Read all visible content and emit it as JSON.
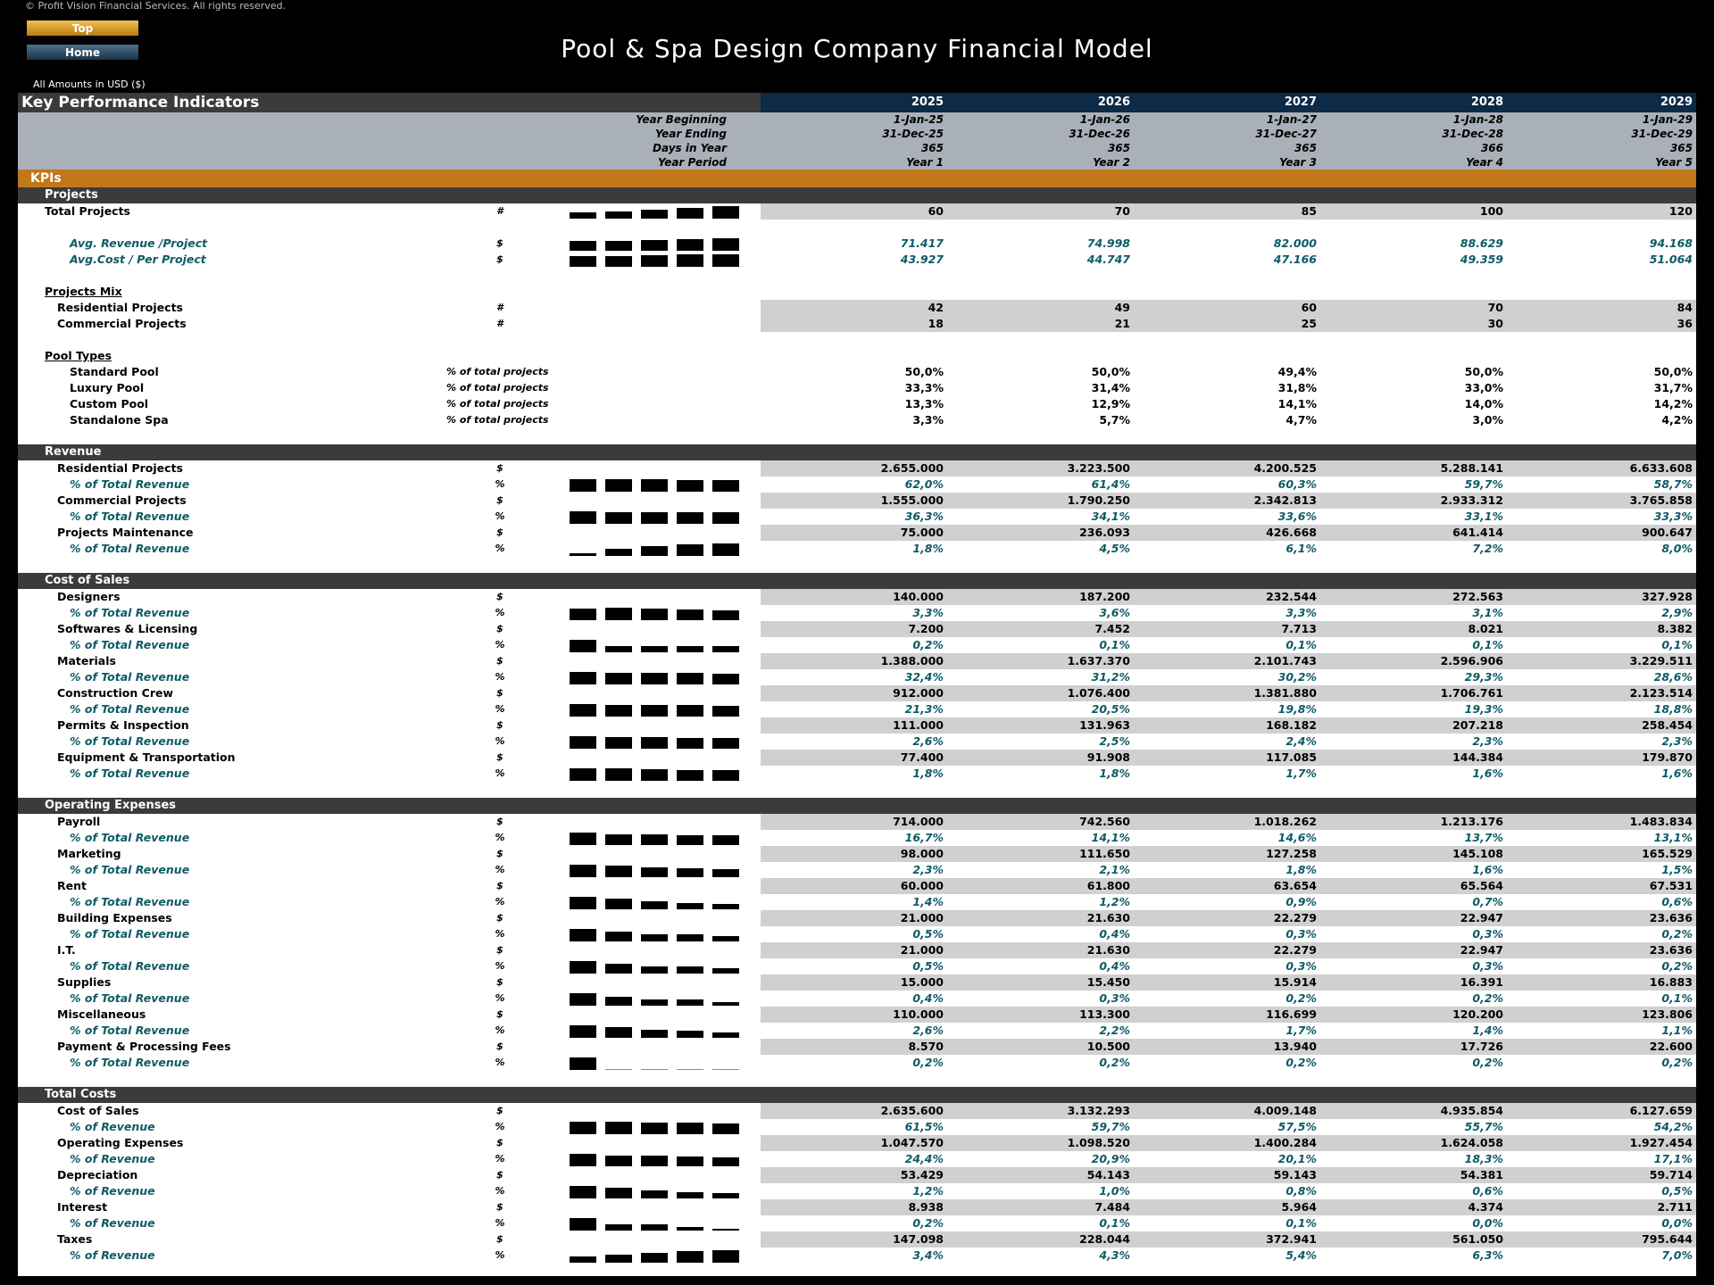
{
  "header": {
    "copyright": "© Profit Vision Financial Services. All rights reserved.",
    "btn_top": "Top",
    "btn_home": "Home",
    "title": "Pool & Spa Design Company Financial Model",
    "amounts": "All Amounts in  USD ($)"
  },
  "table": {
    "title": "Key Performance Indicators",
    "years": [
      "2025",
      "2026",
      "2027",
      "2028",
      "2029"
    ],
    "meta": [
      {
        "label": "Year Beginning",
        "values": [
          "1-Jan-25",
          "1-Jan-26",
          "1-Jan-27",
          "1-Jan-28",
          "1-Jan-29"
        ]
      },
      {
        "label": "Year Ending",
        "values": [
          "31-Dec-25",
          "31-Dec-26",
          "31-Dec-27",
          "31-Dec-28",
          "31-Dec-29"
        ]
      },
      {
        "label": "Days in Year",
        "values": [
          "365",
          "365",
          "365",
          "366",
          "365"
        ]
      },
      {
        "label": "Year Period",
        "values": [
          "Year 1",
          "Year 2",
          "Year 3",
          "Year 4",
          "Year 5"
        ]
      }
    ],
    "band": "KPIs"
  },
  "sections": [
    {
      "type": "sec",
      "label": "Projects"
    },
    {
      "type": "row",
      "style": "main",
      "indent": "l0",
      "label": "Total Projects",
      "unit": "#",
      "spark": [
        60,
        70,
        85,
        100,
        120
      ],
      "values": [
        "60",
        "70",
        "85",
        "100",
        "120"
      ]
    },
    {
      "type": "blank"
    },
    {
      "type": "row",
      "style": "teal",
      "indent": "l2",
      "label": "Avg. Revenue /Project",
      "unit": "$",
      "spark": [
        71.417,
        74.998,
        82.0,
        88.629,
        94.168
      ],
      "values": [
        "71.417",
        "74.998",
        "82.000",
        "88.629",
        "94.168"
      ]
    },
    {
      "type": "row",
      "style": "teal",
      "indent": "l2",
      "label": "Avg.Cost / Per Project",
      "unit": "$",
      "spark": [
        43.927,
        44.747,
        47.166,
        49.359,
        51.064
      ],
      "values": [
        "43.927",
        "44.747",
        "47.166",
        "49.359",
        "51.064"
      ]
    },
    {
      "type": "blank"
    },
    {
      "type": "sub",
      "label": "Projects Mix"
    },
    {
      "type": "row",
      "style": "main",
      "indent": "l1",
      "label": "Residential Projects",
      "unit": "#",
      "values": [
        "42",
        "49",
        "60",
        "70",
        "84"
      ]
    },
    {
      "type": "row",
      "style": "main",
      "indent": "l1",
      "label": "Commercial Projects",
      "unit": "#",
      "values": [
        "18",
        "21",
        "25",
        "30",
        "36"
      ]
    },
    {
      "type": "blank"
    },
    {
      "type": "sub",
      "label": "Pool Types"
    },
    {
      "type": "row",
      "style": "plain",
      "indent": "l2b",
      "label": "Standard Pool",
      "unit": "% of total projects",
      "unitAlign": "l",
      "values": [
        "50,0%",
        "50,0%",
        "49,4%",
        "50,0%",
        "50,0%"
      ]
    },
    {
      "type": "row",
      "style": "plain",
      "indent": "l2b",
      "label": "Luxury Pool",
      "unit": "% of total projects",
      "unitAlign": "l",
      "values": [
        "33,3%",
        "31,4%",
        "31,8%",
        "33,0%",
        "31,7%"
      ]
    },
    {
      "type": "row",
      "style": "plain",
      "indent": "l2b",
      "label": "Custom Pool",
      "unit": "% of total projects",
      "unitAlign": "l",
      "values": [
        "13,3%",
        "12,9%",
        "14,1%",
        "14,0%",
        "14,2%"
      ]
    },
    {
      "type": "row",
      "style": "plain",
      "indent": "l2b",
      "label": "Standalone Spa",
      "unit": "% of total projects",
      "unitAlign": "l",
      "values": [
        "3,3%",
        "5,7%",
        "4,7%",
        "3,0%",
        "4,2%"
      ]
    },
    {
      "type": "blank"
    },
    {
      "type": "sec",
      "label": "Revenue"
    },
    {
      "type": "row",
      "style": "main",
      "indent": "l1",
      "label": "Residential Projects",
      "unit": "$",
      "values": [
        "2.655.000",
        "3.223.500",
        "4.200.525",
        "5.288.141",
        "6.633.608"
      ]
    },
    {
      "type": "row",
      "style": "pct",
      "indent": "l2",
      "label": "% of Total Revenue",
      "unit": "%",
      "spark": [
        62.0,
        61.4,
        60.3,
        59.7,
        58.7
      ],
      "values": [
        "62,0%",
        "61,4%",
        "60,3%",
        "59,7%",
        "58,7%"
      ]
    },
    {
      "type": "row",
      "style": "main",
      "indent": "l1",
      "label": "Commercial Projects",
      "unit": "$",
      "values": [
        "1.555.000",
        "1.790.250",
        "2.342.813",
        "2.933.312",
        "3.765.858"
      ]
    },
    {
      "type": "row",
      "style": "pct",
      "indent": "l2",
      "label": "% of Total Revenue",
      "unit": "%",
      "spark": [
        36.3,
        34.1,
        33.6,
        33.1,
        33.3
      ],
      "values": [
        "36,3%",
        "34,1%",
        "33,6%",
        "33,1%",
        "33,3%"
      ]
    },
    {
      "type": "row",
      "style": "main",
      "indent": "l1",
      "label": "Projects Maintenance",
      "unit": "$",
      "values": [
        "75.000",
        "236.093",
        "426.668",
        "641.414",
        "900.647"
      ]
    },
    {
      "type": "row",
      "style": "pct",
      "indent": "l2",
      "label": "% of Total Revenue",
      "unit": "%",
      "spark": [
        1.8,
        4.5,
        6.1,
        7.2,
        8.0
      ],
      "values": [
        "1,8%",
        "4,5%",
        "6,1%",
        "7,2%",
        "8,0%"
      ]
    },
    {
      "type": "blank"
    },
    {
      "type": "sec",
      "label": "Cost of Sales"
    },
    {
      "type": "row",
      "style": "main",
      "indent": "l1",
      "label": "Designers",
      "unit": "$",
      "values": [
        "140.000",
        "187.200",
        "232.544",
        "272.563",
        "327.928"
      ]
    },
    {
      "type": "row",
      "style": "pct",
      "indent": "l2",
      "label": "% of Total Revenue",
      "unit": "%",
      "spark": [
        3.3,
        3.6,
        3.3,
        3.1,
        2.9
      ],
      "values": [
        "3,3%",
        "3,6%",
        "3,3%",
        "3,1%",
        "2,9%"
      ]
    },
    {
      "type": "row",
      "style": "main",
      "indent": "l1",
      "label": "Softwares & Licensing",
      "unit": "$",
      "values": [
        "7.200",
        "7.452",
        "7.713",
        "8.021",
        "8.382"
      ]
    },
    {
      "type": "row",
      "style": "pct",
      "indent": "l2",
      "label": "% of Total Revenue",
      "unit": "%",
      "spark": [
        0.2,
        0.1,
        0.1,
        0.1,
        0.1
      ],
      "values": [
        "0,2%",
        "0,1%",
        "0,1%",
        "0,1%",
        "0,1%"
      ]
    },
    {
      "type": "row",
      "style": "main",
      "indent": "l1",
      "label": "Materials",
      "unit": "$",
      "values": [
        "1.388.000",
        "1.637.370",
        "2.101.743",
        "2.596.906",
        "3.229.511"
      ]
    },
    {
      "type": "row",
      "style": "pct",
      "indent": "l2",
      "label": "% of Total Revenue",
      "unit": "%",
      "spark": [
        32.4,
        31.2,
        30.2,
        29.3,
        28.6
      ],
      "values": [
        "32,4%",
        "31,2%",
        "30,2%",
        "29,3%",
        "28,6%"
      ]
    },
    {
      "type": "row",
      "style": "main",
      "indent": "l1",
      "label": "Construction Crew",
      "unit": "$",
      "values": [
        "912.000",
        "1.076.400",
        "1.381.880",
        "1.706.761",
        "2.123.514"
      ]
    },
    {
      "type": "row",
      "style": "pct",
      "indent": "l2",
      "label": "% of Total Revenue",
      "unit": "%",
      "spark": [
        21.3,
        20.5,
        19.8,
        19.3,
        18.8
      ],
      "values": [
        "21,3%",
        "20,5%",
        "19,8%",
        "19,3%",
        "18,8%"
      ]
    },
    {
      "type": "row",
      "style": "main",
      "indent": "l1",
      "label": "Permits & Inspection",
      "unit": "$",
      "values": [
        "111.000",
        "131.963",
        "168.182",
        "207.218",
        "258.454"
      ]
    },
    {
      "type": "row",
      "style": "pct",
      "indent": "l2",
      "label": "% of Total Revenue",
      "unit": "%",
      "spark": [
        2.6,
        2.5,
        2.4,
        2.3,
        2.3
      ],
      "values": [
        "2,6%",
        "2,5%",
        "2,4%",
        "2,3%",
        "2,3%"
      ]
    },
    {
      "type": "row",
      "style": "main",
      "indent": "l1",
      "label": "Equipment & Transportation",
      "unit": "$",
      "values": [
        "77.400",
        "91.908",
        "117.085",
        "144.384",
        "179.870"
      ]
    },
    {
      "type": "row",
      "style": "pct",
      "indent": "l2",
      "label": "% of Total Revenue",
      "unit": "%",
      "spark": [
        1.8,
        1.8,
        1.7,
        1.6,
        1.6
      ],
      "values": [
        "1,8%",
        "1,8%",
        "1,7%",
        "1,6%",
        "1,6%"
      ]
    },
    {
      "type": "blank"
    },
    {
      "type": "sec",
      "label": "Operating Expenses"
    },
    {
      "type": "row",
      "style": "main",
      "indent": "l1",
      "label": "Payroll",
      "unit": "$",
      "values": [
        "714.000",
        "742.560",
        "1.018.262",
        "1.213.176",
        "1.483.834"
      ]
    },
    {
      "type": "row",
      "style": "pct",
      "indent": "l2",
      "label": "% of Total Revenue",
      "unit": "%",
      "spark": [
        16.7,
        14.1,
        14.6,
        13.7,
        13.1
      ],
      "values": [
        "16,7%",
        "14,1%",
        "14,6%",
        "13,7%",
        "13,1%"
      ]
    },
    {
      "type": "row",
      "style": "main",
      "indent": "l1",
      "label": "Marketing",
      "unit": "$",
      "values": [
        "98.000",
        "111.650",
        "127.258",
        "145.108",
        "165.529"
      ]
    },
    {
      "type": "row",
      "style": "pct",
      "indent": "l2",
      "label": "% of Total Revenue",
      "unit": "%",
      "spark": [
        2.3,
        2.1,
        1.8,
        1.6,
        1.5
      ],
      "values": [
        "2,3%",
        "2,1%",
        "1,8%",
        "1,6%",
        "1,5%"
      ]
    },
    {
      "type": "row",
      "style": "main",
      "indent": "l1",
      "label": "Rent",
      "unit": "$",
      "values": [
        "60.000",
        "61.800",
        "63.654",
        "65.564",
        "67.531"
      ]
    },
    {
      "type": "row",
      "style": "pct",
      "indent": "l2",
      "label": "% of Total Revenue",
      "unit": "%",
      "spark": [
        1.4,
        1.2,
        0.9,
        0.7,
        0.6
      ],
      "values": [
        "1,4%",
        "1,2%",
        "0,9%",
        "0,7%",
        "0,6%"
      ]
    },
    {
      "type": "row",
      "style": "main",
      "indent": "l1",
      "label": "Building Expenses",
      "unit": "$",
      "values": [
        "21.000",
        "21.630",
        "22.279",
        "22.947",
        "23.636"
      ]
    },
    {
      "type": "row",
      "style": "pct",
      "indent": "l2",
      "label": "% of Total Revenue",
      "unit": "%",
      "spark": [
        0.5,
        0.4,
        0.3,
        0.3,
        0.2
      ],
      "values": [
        "0,5%",
        "0,4%",
        "0,3%",
        "0,3%",
        "0,2%"
      ]
    },
    {
      "type": "row",
      "style": "main",
      "indent": "l1",
      "label": "I.T.",
      "unit": "$",
      "values": [
        "21.000",
        "21.630",
        "22.279",
        "22.947",
        "23.636"
      ]
    },
    {
      "type": "row",
      "style": "pct",
      "indent": "l2",
      "label": "% of Total Revenue",
      "unit": "%",
      "spark": [
        0.5,
        0.4,
        0.3,
        0.3,
        0.2
      ],
      "values": [
        "0,5%",
        "0,4%",
        "0,3%",
        "0,3%",
        "0,2%"
      ]
    },
    {
      "type": "row",
      "style": "main",
      "indent": "l1",
      "label": "Supplies",
      "unit": "$",
      "values": [
        "15.000",
        "15.450",
        "15.914",
        "16.391",
        "16.883"
      ]
    },
    {
      "type": "row",
      "style": "pct",
      "indent": "l2",
      "label": "% of Total Revenue",
      "unit": "%",
      "spark": [
        0.4,
        0.3,
        0.2,
        0.2,
        0.1
      ],
      "values": [
        "0,4%",
        "0,3%",
        "0,2%",
        "0,2%",
        "0,1%"
      ]
    },
    {
      "type": "row",
      "style": "main",
      "indent": "l1",
      "label": "Miscellaneous",
      "unit": "$",
      "values": [
        "110.000",
        "113.300",
        "116.699",
        "120.200",
        "123.806"
      ]
    },
    {
      "type": "row",
      "style": "pct",
      "indent": "l2",
      "label": "% of Total Revenue",
      "unit": "%",
      "spark": [
        2.6,
        2.2,
        1.7,
        1.4,
        1.1
      ],
      "values": [
        "2,6%",
        "2,2%",
        "1,7%",
        "1,4%",
        "1,1%"
      ]
    },
    {
      "type": "row",
      "style": "main",
      "indent": "l1",
      "label": "Payment & Processing Fees",
      "unit": "$",
      "values": [
        "8.570",
        "10.500",
        "13.940",
        "17.726",
        "22.600"
      ]
    },
    {
      "type": "row",
      "style": "pct",
      "indent": "l2",
      "label": "% of Total Revenue",
      "unit": "%",
      "spark": [
        0.2,
        0.0,
        0.0,
        0.0,
        0.0
      ],
      "values": [
        "0,2%",
        "0,2%",
        "0,2%",
        "0,2%",
        "0,2%"
      ]
    },
    {
      "type": "blank"
    },
    {
      "type": "sec",
      "label": "Total Costs"
    },
    {
      "type": "row",
      "style": "main",
      "indent": "l1",
      "label": "Cost of Sales",
      "unit": "$",
      "values": [
        "2.635.600",
        "3.132.293",
        "4.009.148",
        "4.935.854",
        "6.127.659"
      ]
    },
    {
      "type": "row",
      "style": "pct",
      "indent": "l2",
      "label": "% of Revenue",
      "unit": "%",
      "spark": [
        61.5,
        59.7,
        57.5,
        55.7,
        54.2
      ],
      "values": [
        "61,5%",
        "59,7%",
        "57,5%",
        "55,7%",
        "54,2%"
      ]
    },
    {
      "type": "row",
      "style": "main",
      "indent": "l1",
      "label": "Operating Expenses",
      "unit": "$",
      "values": [
        "1.047.570",
        "1.098.520",
        "1.400.284",
        "1.624.058",
        "1.927.454"
      ]
    },
    {
      "type": "row",
      "style": "pct",
      "indent": "l2",
      "label": "% of Revenue",
      "unit": "%",
      "spark": [
        24.4,
        20.9,
        20.1,
        18.3,
        17.1
      ],
      "values": [
        "24,4%",
        "20,9%",
        "20,1%",
        "18,3%",
        "17,1%"
      ]
    },
    {
      "type": "row",
      "style": "main",
      "indent": "l1",
      "label": "Depreciation",
      "unit": "$",
      "values": [
        "53.429",
        "54.143",
        "59.143",
        "54.381",
        "59.714"
      ]
    },
    {
      "type": "row",
      "style": "pct",
      "indent": "l2",
      "label": "% of Revenue",
      "unit": "%",
      "spark": [
        1.2,
        1.0,
        0.8,
        0.6,
        0.5
      ],
      "values": [
        "1,2%",
        "1,0%",
        "0,8%",
        "0,6%",
        "0,5%"
      ]
    },
    {
      "type": "row",
      "style": "main",
      "indent": "l1",
      "label": "Interest",
      "unit": "$",
      "values": [
        "8.938",
        "7.484",
        "5.964",
        "4.374",
        "2.711"
      ]
    },
    {
      "type": "row",
      "style": "pct",
      "indent": "l2",
      "label": "% of Revenue",
      "unit": "%",
      "spark": [
        0.2,
        0.1,
        0.1,
        0.05,
        0.03
      ],
      "values": [
        "0,2%",
        "0,1%",
        "0,1%",
        "0,0%",
        "0,0%"
      ]
    },
    {
      "type": "row",
      "style": "main",
      "indent": "l1",
      "label": "Taxes",
      "unit": "$",
      "values": [
        "147.098",
        "228.044",
        "372.941",
        "561.050",
        "795.644"
      ]
    },
    {
      "type": "row",
      "style": "pct",
      "indent": "l2",
      "label": "% of Revenue",
      "unit": "%",
      "spark": [
        3.4,
        4.3,
        5.4,
        6.3,
        7.0
      ],
      "values": [
        "3,4%",
        "4,3%",
        "5,4%",
        "6,3%",
        "7,0%"
      ]
    }
  ]
}
